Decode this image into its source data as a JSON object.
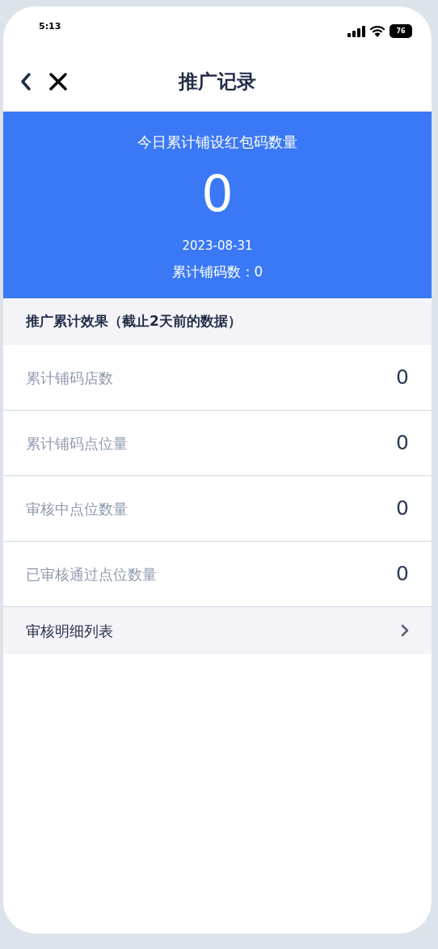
{
  "status_bar": {
    "time": "5:13",
    "battery": "76"
  },
  "nav": {
    "title": "推广记录"
  },
  "banner": {
    "title": "今日累计铺设红包码数量",
    "count": "0",
    "date": "2023-08-31",
    "total": "累计铺码数：0"
  },
  "section": {
    "title": "推广累计效果（截止2天前的数据）"
  },
  "stats": [
    {
      "label": "累计铺码店数",
      "value": "0"
    },
    {
      "label": "累计铺码点位量",
      "value": "0"
    },
    {
      "label": "审核中点位数量",
      "value": "0"
    },
    {
      "label": "已审核通过点位数量",
      "value": "0"
    }
  ],
  "detail_link": {
    "label": "审核明细列表"
  }
}
